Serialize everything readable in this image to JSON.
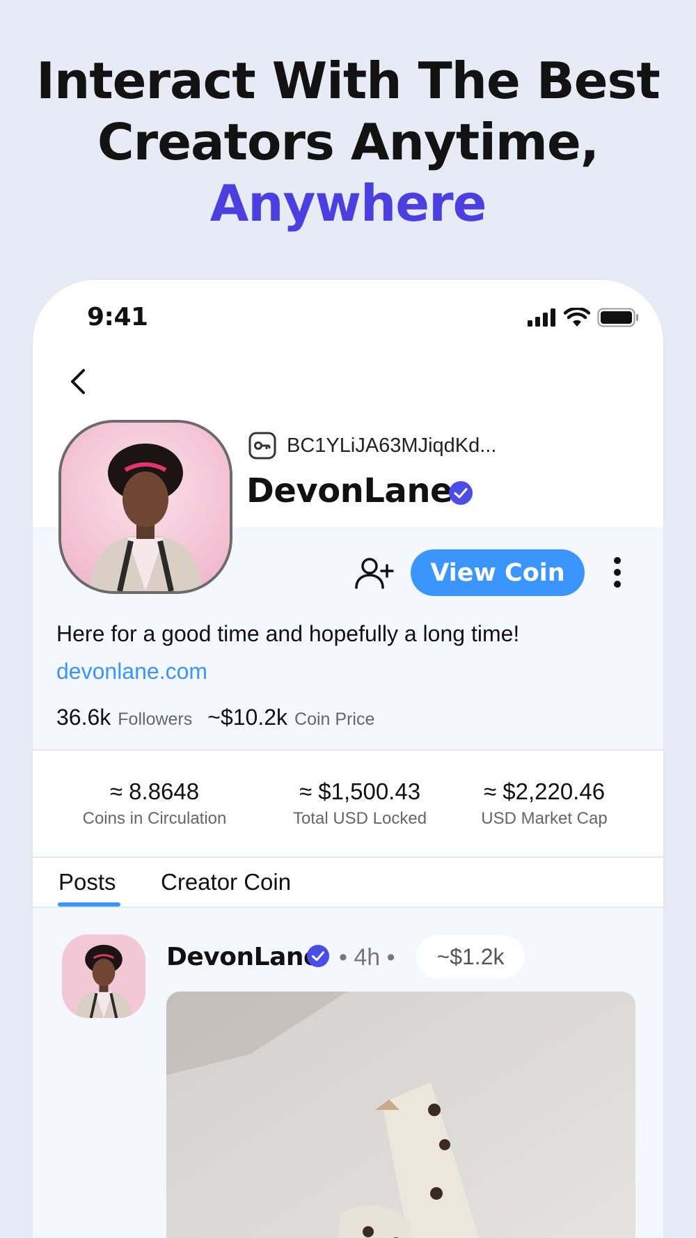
{
  "headline": {
    "line1": "Interact With The Best",
    "line2": "Creators Anytime,",
    "accent": "Anywhere"
  },
  "status_bar": {
    "time": "9:41",
    "icons": [
      "cellular-signal-icon",
      "wifi-icon",
      "battery-icon"
    ]
  },
  "profile": {
    "wallet_key": "BC1YLiJA63MJiqdKd...",
    "username": "DevonLane",
    "verified": true,
    "view_coin_label": "View Coin",
    "bio": "Here for a good time and hopefully a long time!",
    "link": "devonlane.com",
    "followers_value": "36.6k",
    "followers_label": "Followers",
    "coin_price_value": "~$10.2k",
    "coin_price_label": "Coin Price"
  },
  "metrics": [
    {
      "value": "≈ 8.8648",
      "label": "Coins in Circulation"
    },
    {
      "value": "≈ $1,500.43",
      "label": "Total USD Locked"
    },
    {
      "value": "≈ $2,220.46",
      "label": "USD Market Cap"
    }
  ],
  "tabs": [
    {
      "label": "Posts",
      "active": true
    },
    {
      "label": "Creator Coin",
      "active": false
    }
  ],
  "post": {
    "username": "DevonLane",
    "meta": "• 4h •",
    "price": "~$1.2k"
  },
  "colors": {
    "accent_blue": "#3a95ff",
    "headline_accent": "#4b3fe0",
    "verified": "#4b4ee6",
    "background": "#e7ebf5"
  }
}
